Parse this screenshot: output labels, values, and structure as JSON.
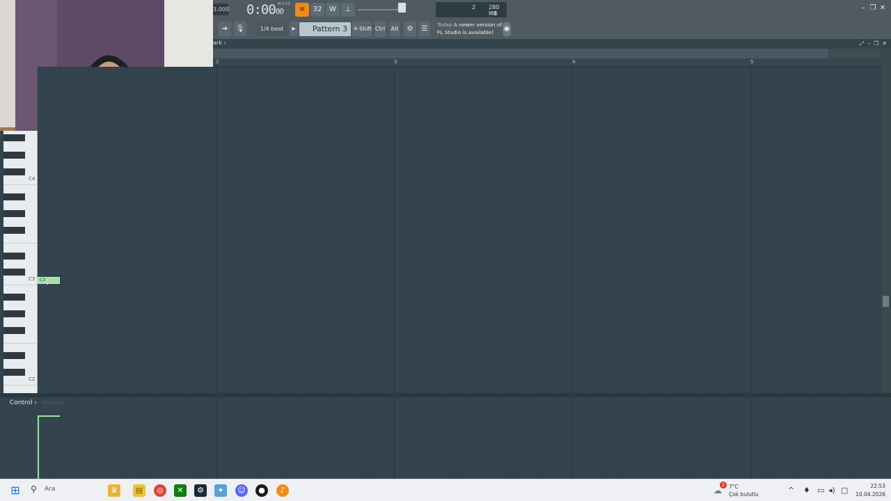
{
  "toolbar": {
    "tempo_fragment": "3.000",
    "time": "0:00",
    "time_ms": "00",
    "time_unit": "M:S:CS",
    "pattern_icon_label": "≡",
    "song_mode_label": "32",
    "wait_label": "W",
    "metronome_label": "⊥",
    "cpu_value": "2",
    "memory": "280 MB",
    "polyphony": "1",
    "snap_label": "1/4 beat",
    "pattern_name": "Pattern 3",
    "shift_label": "Shift",
    "ctrl_label": "Ctrl",
    "alt_label": "Alt",
    "news_today": "Today",
    "news_text_line1": "A newer version of",
    "news_text_line2": "FL Studio is available!"
  },
  "piano_roll": {
    "title_fragment": "ark",
    "ruler_numbers": [
      "2",
      "3",
      "4",
      "5"
    ],
    "keys": [
      "C4",
      "C3",
      "C2"
    ],
    "note_label": "C3"
  },
  "control": {
    "label": "Control",
    "target": "Velocity"
  },
  "taskbar": {
    "search_placeholder": "Ara",
    "weather_temp": "7°C",
    "weather_desc": "Çok bulutlu",
    "weather_badge": "2",
    "time": "22:53",
    "date": "10.04.2026"
  },
  "colors": {
    "accent_orange": "#f08a1a",
    "note_green": "#9fe3a4",
    "grid_bg": "#34444e"
  }
}
